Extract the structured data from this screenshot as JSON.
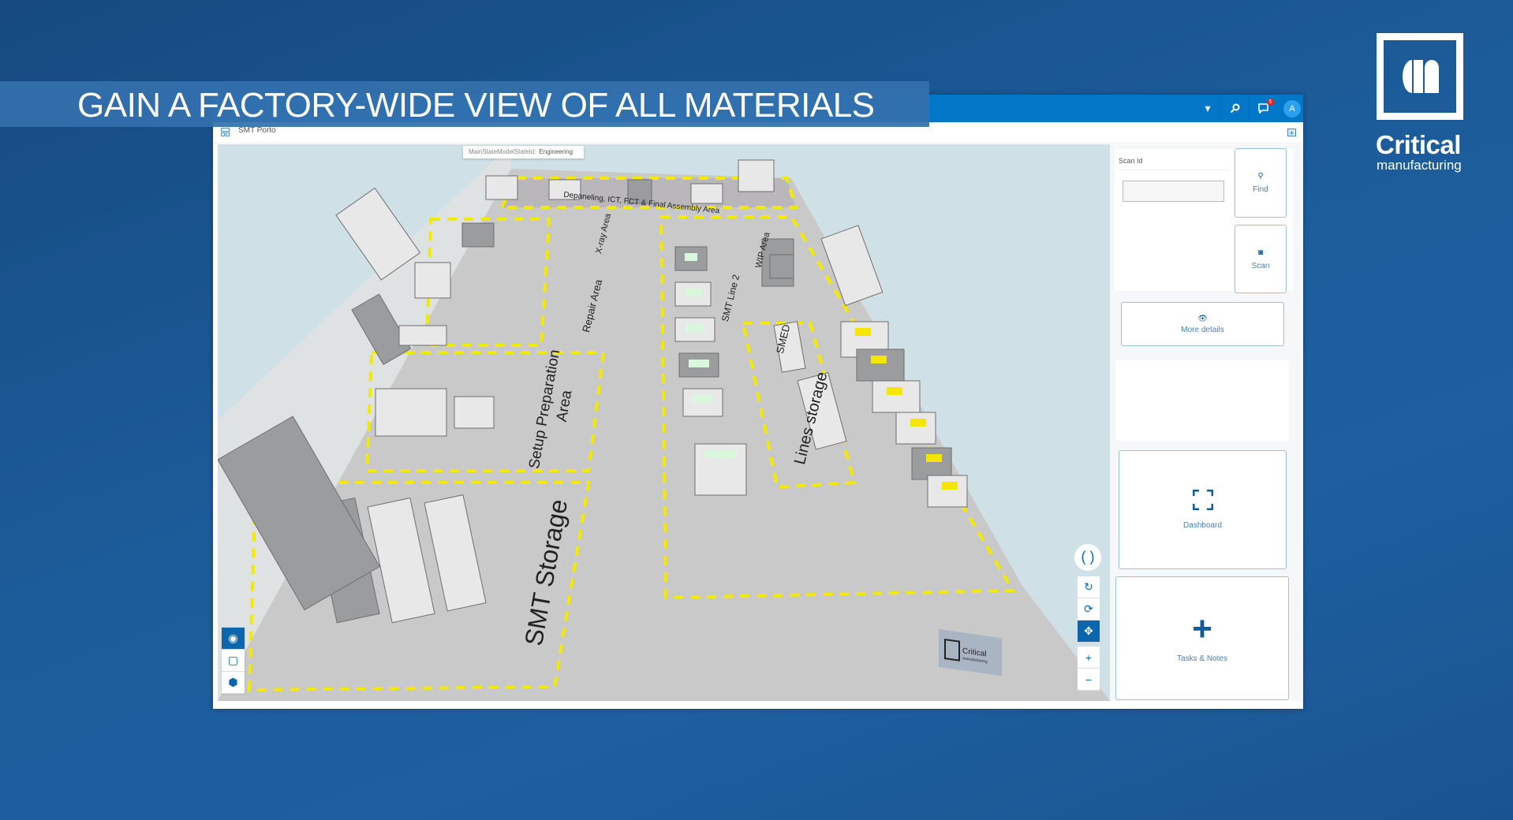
{
  "banner": {
    "title": "GAIN A FACTORY-WIDE VIEW OF ALL MATERIALS"
  },
  "brand": {
    "name": "Critical",
    "tagline": "manufacturing"
  },
  "header": {
    "notifications_count": "5",
    "avatar_initial": "A",
    "accent_color": "#0277c8"
  },
  "page": {
    "title": "SMT Porto"
  },
  "viewport": {
    "tooltip": {
      "key": "MainStateModelStateId:",
      "value": "Engineering"
    },
    "areas": {
      "smt_storage": "SMT Storage",
      "setup_prep_line1": "Setup Preparation",
      "setup_prep_line2": "Area",
      "repair": "Repair Area",
      "xray": "X-ray Area",
      "smt_line2": "SMT Line 2",
      "wip": "WIP Area",
      "smed": "SMED",
      "lines_storage": "Lines storage",
      "final_assembly": "Depaneling, ICT, FCT & Final Assembly Area"
    },
    "floor_logo": {
      "name": "Critical",
      "tagline": "manufacturing"
    }
  },
  "panel": {
    "scan_label": "Scan Id",
    "scan_value": "",
    "find_label": "Find",
    "scan_button_label": "Scan",
    "more_details_label": "More details",
    "dashboard_label": "Dashboard",
    "tasks_label": "Tasks & Notes"
  }
}
